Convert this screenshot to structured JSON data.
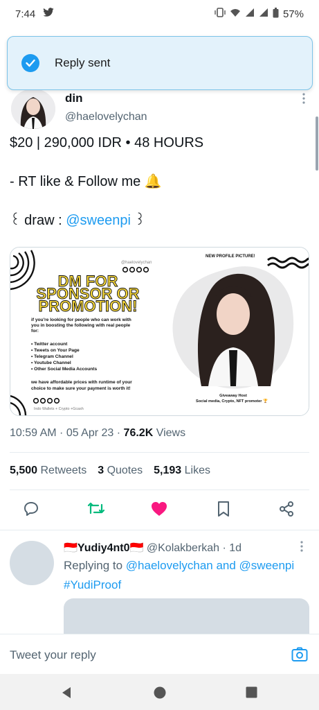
{
  "status_bar": {
    "time": "7:44",
    "battery": "57%"
  },
  "toast": {
    "message": "Reply sent"
  },
  "tweet": {
    "display_name": "din",
    "handle": "@haelovelychan",
    "line1": "$20 | 290,000 IDR • 48 HOURS",
    "line2": "- RT like & Follow me 🔔",
    "draw_prefix": "꒰ draw : ",
    "draw_mention": "@sweenpi",
    "draw_suffix": " ꒱",
    "timestamp": "10:59 AM · 05 Apr 23 · ",
    "views_count": "76.2K",
    "views_label": " Views",
    "stats": {
      "retweets_count": "5,500",
      "retweets_label": "Retweets",
      "quotes_count": "3",
      "quotes_label": "Quotes",
      "likes_count": "5,193",
      "likes_label": "Likes"
    }
  },
  "media": {
    "small_handle": "@haelovelychan",
    "headline_1": "DM FOR",
    "headline_2": "SPONSOR OR",
    "headline_3": "PROMOTION!",
    "intro_1": "if you're looking for people who can work with",
    "intro_2": "you in boosting the following with real people",
    "intro_3": "for:",
    "bullets": [
      "• Twitter account",
      "• Tweets on Your Page",
      "• Telegram Channel",
      "• Youtube Channel",
      "• Other Social Media Accounts"
    ],
    "outro_1": "we have affordable prices with runtime of your",
    "outro_2": "choice to make sure your payment is worth it!",
    "footer": "Indo Wallets + Crypto +Gcash",
    "new_profile": "NEW PROFILE PICTURE!",
    "host_label": "Giveaway Host",
    "host_sub": "Social media, Crypto, NFT promoter 🏆"
  },
  "reply": {
    "name": "🇮🇩Yudiy4nt0🇮🇩",
    "handle": "@Kolakberkah",
    "time": " · 1d",
    "replying_prefix": "Replying to ",
    "replying_users": "@haelovelychan and @sweenpi",
    "tag": "#YudiProof"
  },
  "compose": {
    "placeholder": "Tweet your reply"
  },
  "colors": {
    "accent": "#1d9bf0",
    "retweet": "#00ba7c",
    "like": "#f91880"
  }
}
